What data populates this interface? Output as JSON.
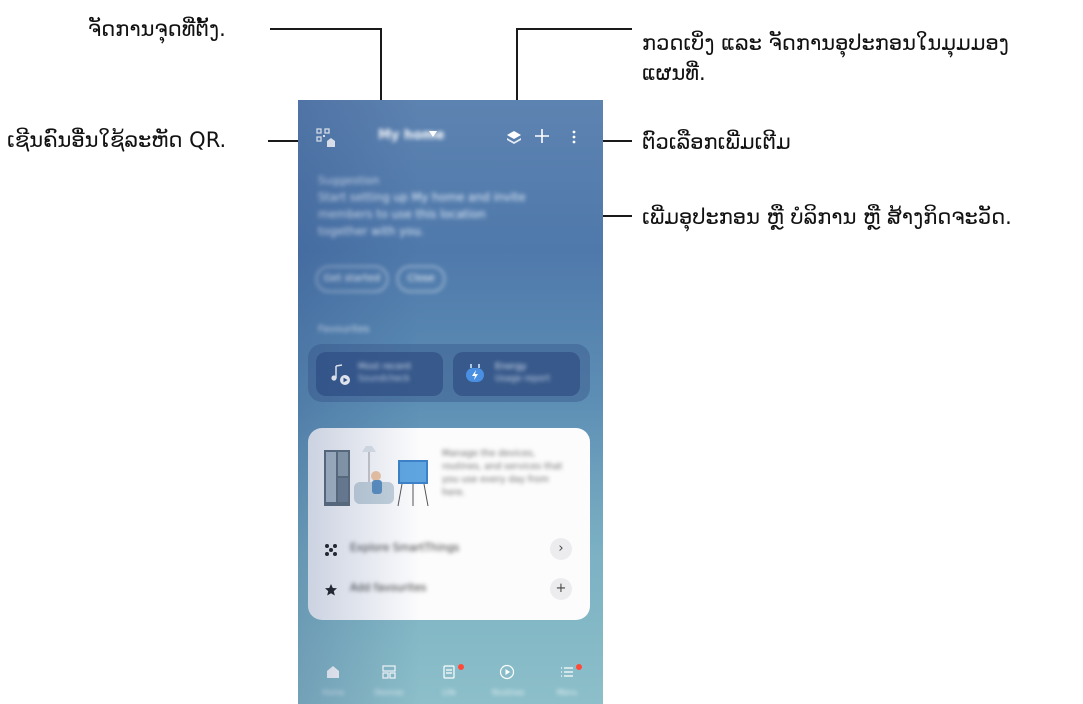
{
  "annotations": {
    "manage_locations": "ຈັດການຈຸດທີ່ຕັ້ງ.",
    "invite_qr": "ເຊີນຄົນອື່ນໃຊ້ລະຫັດ QR.",
    "map_view_line1": "ກວດເບິ່ງ ແລະ ຈັດການອຸປະກອນໃນມຸມມອງ",
    "map_view_line2": "ແຜນທີ່.",
    "more_options": "ຕົວເລືອກເພີ່ມເຕີມ",
    "add_device": "ເພີ່ມອຸປະກອນ ຫຼື ບໍລິການ ຫຼື ສ້າງກິດຈະວັດ."
  },
  "phone": {
    "home_name": "My home",
    "icons": {
      "qr": "qr-home-icon",
      "map": "map-view-icon",
      "add": "plus-icon",
      "more": "more-vertical-icon"
    },
    "suggestion": {
      "title": "Suggestion",
      "text": "Start setting up My home and invite members to use this location together with you.",
      "chip_primary": "Get started",
      "chip_secondary": "Close"
    },
    "favourites": {
      "title": "Favourites",
      "cards": [
        {
          "label": "Most recent",
          "sub": "Soundcheck",
          "icon": "music-play-icon"
        },
        {
          "label": "Energy",
          "sub": "Usage report",
          "icon": "energy-plug-icon"
        }
      ]
    },
    "promo": {
      "description": "Manage the devices, routines, and services that you use every day from here.",
      "rows": [
        {
          "label": "Explore SmartThings",
          "icon": "smartthings-icon",
          "button": "›"
        },
        {
          "label": "Add favourites",
          "icon": "star-icon",
          "button": "+"
        }
      ]
    },
    "nav": [
      {
        "label": "Home",
        "icon": "home-icon",
        "badge": false
      },
      {
        "label": "Devices",
        "icon": "devices-icon",
        "badge": false
      },
      {
        "label": "Life",
        "icon": "life-icon",
        "badge": true
      },
      {
        "label": "Routines",
        "icon": "routines-icon",
        "badge": false
      },
      {
        "label": "Menu",
        "icon": "menu-icon",
        "badge": true
      }
    ]
  },
  "colors": {
    "badge": "#ff4a3a",
    "annotation_line": "#1a1a1a"
  }
}
